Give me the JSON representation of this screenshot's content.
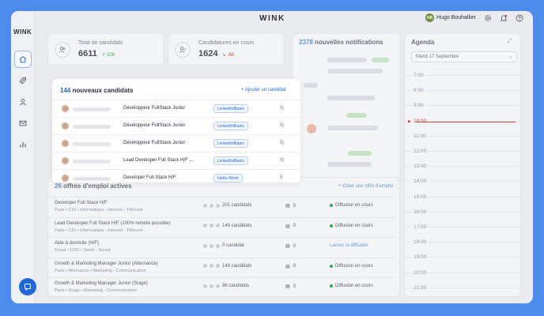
{
  "app": {
    "brand": "WINK",
    "side_logo": "WINK"
  },
  "user": {
    "initials": "HB",
    "name": "Hugo Bouhallier"
  },
  "topbar_icons": [
    "gear-icon",
    "bell-icon",
    "help-icon"
  ],
  "sidebar_items": [
    {
      "name": "home-icon",
      "active": true
    },
    {
      "name": "rocket-icon",
      "active": false
    },
    {
      "name": "user-icon",
      "active": false
    },
    {
      "name": "mail-icon",
      "active": false
    },
    {
      "name": "chart-icon",
      "active": false
    }
  ],
  "stats": {
    "candidates": {
      "label": "Total de candidats",
      "value": "6611",
      "delta": "108",
      "trend": "up"
    },
    "in_progress": {
      "label": "Candidatures en cours",
      "value": "1624",
      "delta": "-60",
      "trend": "down"
    }
  },
  "notifications": {
    "count": "2378",
    "label": "nouvelles notifications"
  },
  "new_candidates": {
    "count": "144",
    "label": "nouveaux candidats",
    "add_label": "+ Ajouter un candidat",
    "rows": [
      {
        "job": "Développeur FullStack Junior",
        "source": "LinkedInBasic",
        "time": "0j"
      },
      {
        "job": "Développeur FullStack Junior",
        "source": "LinkedInBasic",
        "time": "0j"
      },
      {
        "job": "Développeur FullStack Junior",
        "source": "LinkedInBasic",
        "time": "0j"
      },
      {
        "job": "Lead Developer Full Stack H/F ...",
        "source": "LinkedInBasic",
        "time": "0j"
      },
      {
        "job": "Developer Full Stack H/F",
        "source": "Hello Work",
        "time": "5"
      }
    ]
  },
  "offers": {
    "count": "26",
    "label": "offres d'emploi actives",
    "create_label": "+ Créer une offre d'emploi",
    "rows": [
      {
        "title": "Developer Full Stack H/F",
        "meta": "Paris • CDI • Informatique - Internet - Télécom",
        "candidates": "201 candidats",
        "messages": "0",
        "status": "Diffusion en cours",
        "active": true
      },
      {
        "title": "Lead Developer Full Stack H/F (100% remote possible)",
        "meta": "Paris • CDI • Informatique - Internet - Télécom",
        "candidates": "148 candidats",
        "messages": "0",
        "status": "Diffusion en cours",
        "active": true
      },
      {
        "title": "Aide à domicile (H/F)",
        "meta": "Douai • CDD • Santé - Social",
        "candidates": "0 candidat",
        "messages": "0",
        "status": "Lancer la diffusion",
        "active": false
      },
      {
        "title": "Growth & Marketing Manager Junior (Alternance)",
        "meta": "Paris • Alternance • Marketing - Communication",
        "candidates": "148 candidats",
        "messages": "0",
        "status": "Diffusion en cours",
        "active": true
      },
      {
        "title": "Growth & Marketing Manager Junior (Stage)",
        "meta": "Paris • Stage • Marketing - Communication",
        "candidates": "96 candidats",
        "messages": "0",
        "status": "Diffusion en cours",
        "active": true
      }
    ]
  },
  "agenda": {
    "title": "Agenda",
    "date": "Mardi 17 Septembre",
    "hours": [
      "7:00",
      "8:00",
      "9:00",
      "10:00",
      "11:00",
      "12:00",
      "13:00",
      "14:00",
      "15:00",
      "16:00",
      "17:00",
      "18:00",
      "19:00",
      "20:00",
      "21:00"
    ],
    "current_hour": "10:00"
  },
  "colors": {
    "accent": "#2368d8",
    "background": "#4a8bec",
    "positive": "#3aa657",
    "negative": "#d0453c"
  }
}
